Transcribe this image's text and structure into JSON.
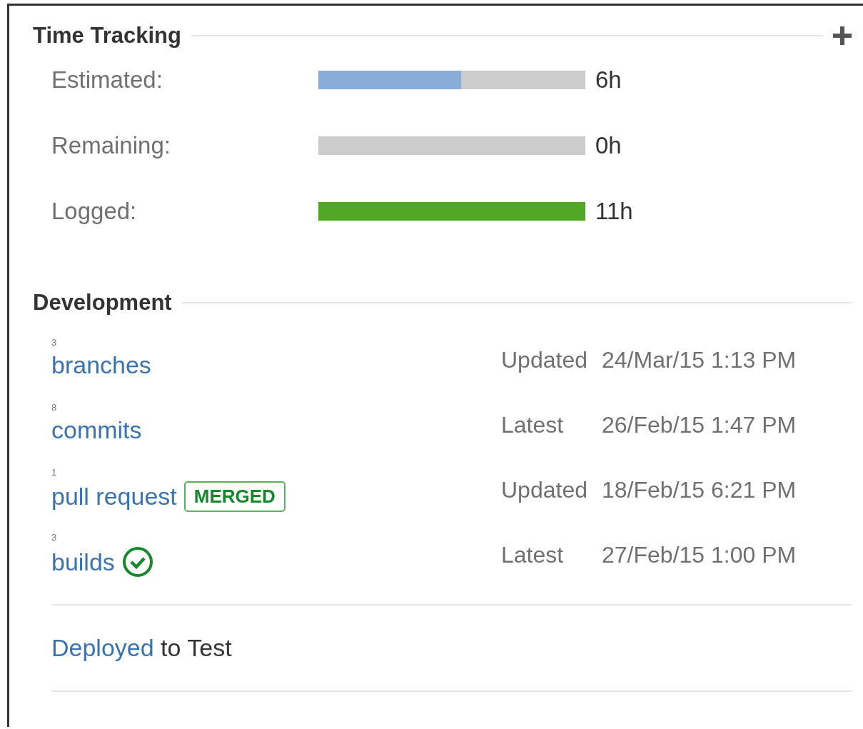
{
  "time_tracking": {
    "title": "Time Tracking",
    "rows": [
      {
        "label": "Estimated:",
        "level": 0.536,
        "color": "#89acd8",
        "value": "6h"
      },
      {
        "label": "Remaining:",
        "value": "0h"
      },
      {
        "label": "Logged:",
        "level": 1,
        "color": "#51a825",
        "value": "11h"
      }
    ]
  },
  "development": {
    "title": "Development",
    "items": [
      {
        "count": "3",
        "link": "branches",
        "kind": "plain",
        "status_label": "Updated",
        "date": "24/Mar/15 1:13 PM"
      },
      {
        "count": "8",
        "link": "commits",
        "kind": "plain",
        "status_label": "Latest",
        "date": "26/Feb/15 1:47 PM"
      },
      {
        "count": "1",
        "link": "pull request",
        "kind": "lozenge",
        "lozenge": "MERGED",
        "status_label": "Updated",
        "date": "18/Feb/15 6:21 PM"
      },
      {
        "count": "3",
        "link": "builds",
        "kind": "passed",
        "status_label": "Latest",
        "date": "27/Feb/15 1:00 PM"
      }
    ],
    "deployment": {
      "link": "Deployed",
      "text": " to Test"
    }
  }
}
